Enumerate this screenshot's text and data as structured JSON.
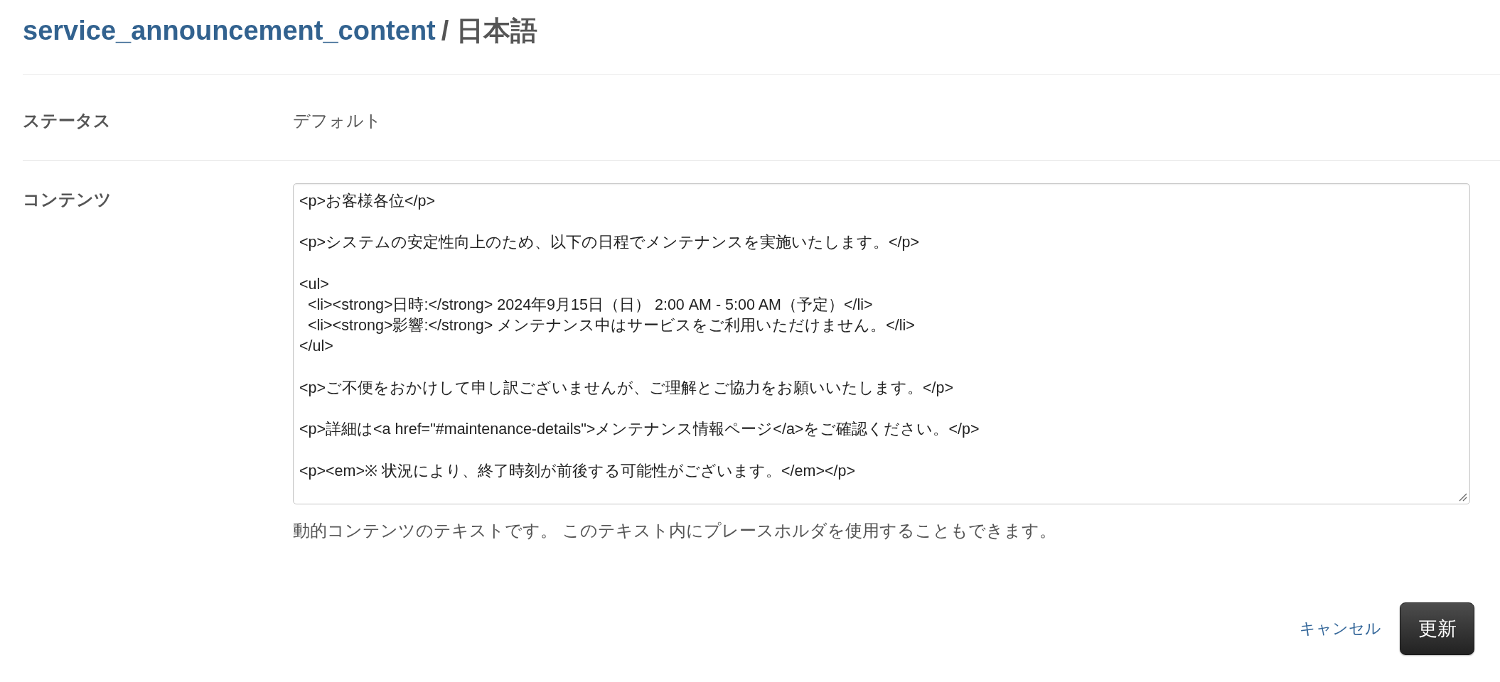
{
  "header": {
    "parent": "service_announcement_content",
    "current": "/ 日本語"
  },
  "fields": [
    {
      "kind": "text",
      "label": "ステータス",
      "value": "デフォルト"
    },
    {
      "kind": "textarea",
      "label": "コンテンツ",
      "value": "<p>お客様各位</p>\n\n<p>システムの安定性向上のため、以下の日程でメンテナンスを実施いたします。</p>\n\n<ul>\n  <li><strong>日時:</strong> 2024年9月15日（日） 2:00 AM - 5:00 AM（予定）</li>\n  <li><strong>影響:</strong> メンテナンス中はサービスをご利用いただけません。</li>\n</ul>\n\n<p>ご不便をおかけして申し訳ございませんが、ご理解とご協力をお願いいたします。</p>\n\n<p>詳細は<a href=\"#maintenance-details\">メンテナンス情報ページ</a>をご確認ください。</p>\n\n<p><em>※ 状況により、終了時刻が前後する可能性がございます。</em></p>",
      "help": "動的コンテンツのテキストです。 このテキスト内にプレースホルダを使用することもできます。"
    }
  ],
  "actions": [
    {
      "kind": "link",
      "label": "キャンセル"
    },
    {
      "kind": "primary",
      "label": "更新"
    }
  ]
}
